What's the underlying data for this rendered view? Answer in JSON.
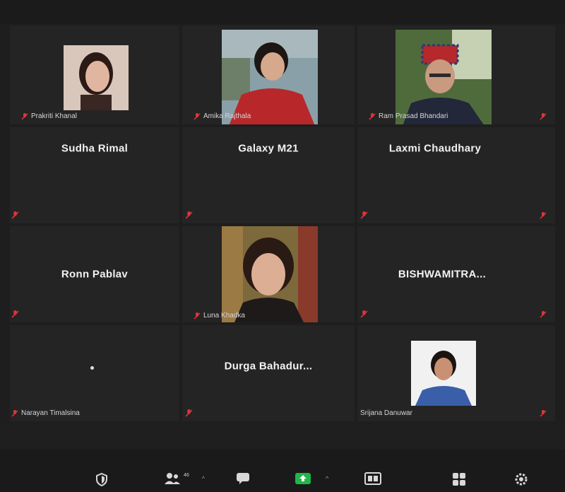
{
  "participants": [
    {
      "name": "Prakriti Khanal"
    },
    {
      "name": "Amika Rajthala"
    },
    {
      "name": "Ram Prasad Bhandari"
    },
    {
      "name": "Sudha Rimal"
    },
    {
      "name": "Galaxy M21"
    },
    {
      "name": "Laxmi Chaudhary"
    },
    {
      "name": "Ronn Pablav"
    },
    {
      "name": "Luna Khadka"
    },
    {
      "name": "BISHWAMITRA..."
    },
    {
      "name": "Narayan Timalsina"
    },
    {
      "name": "Durga  Bahadur..."
    },
    {
      "name": "Srijana Danuwar"
    }
  ],
  "toolbar": {
    "participants_count": "46"
  },
  "icons": {
    "muted": "mic-muted-icon",
    "security": "shield-icon",
    "participants": "participants-icon",
    "chat": "chat-icon",
    "share": "share-screen-icon",
    "record": "record-icon",
    "gallery": "gallery-view-icon",
    "settings": "settings-icon"
  },
  "colors": {
    "muted_red": "#e0343a",
    "share_green": "#21b54a",
    "tile_bg": "#242424"
  }
}
